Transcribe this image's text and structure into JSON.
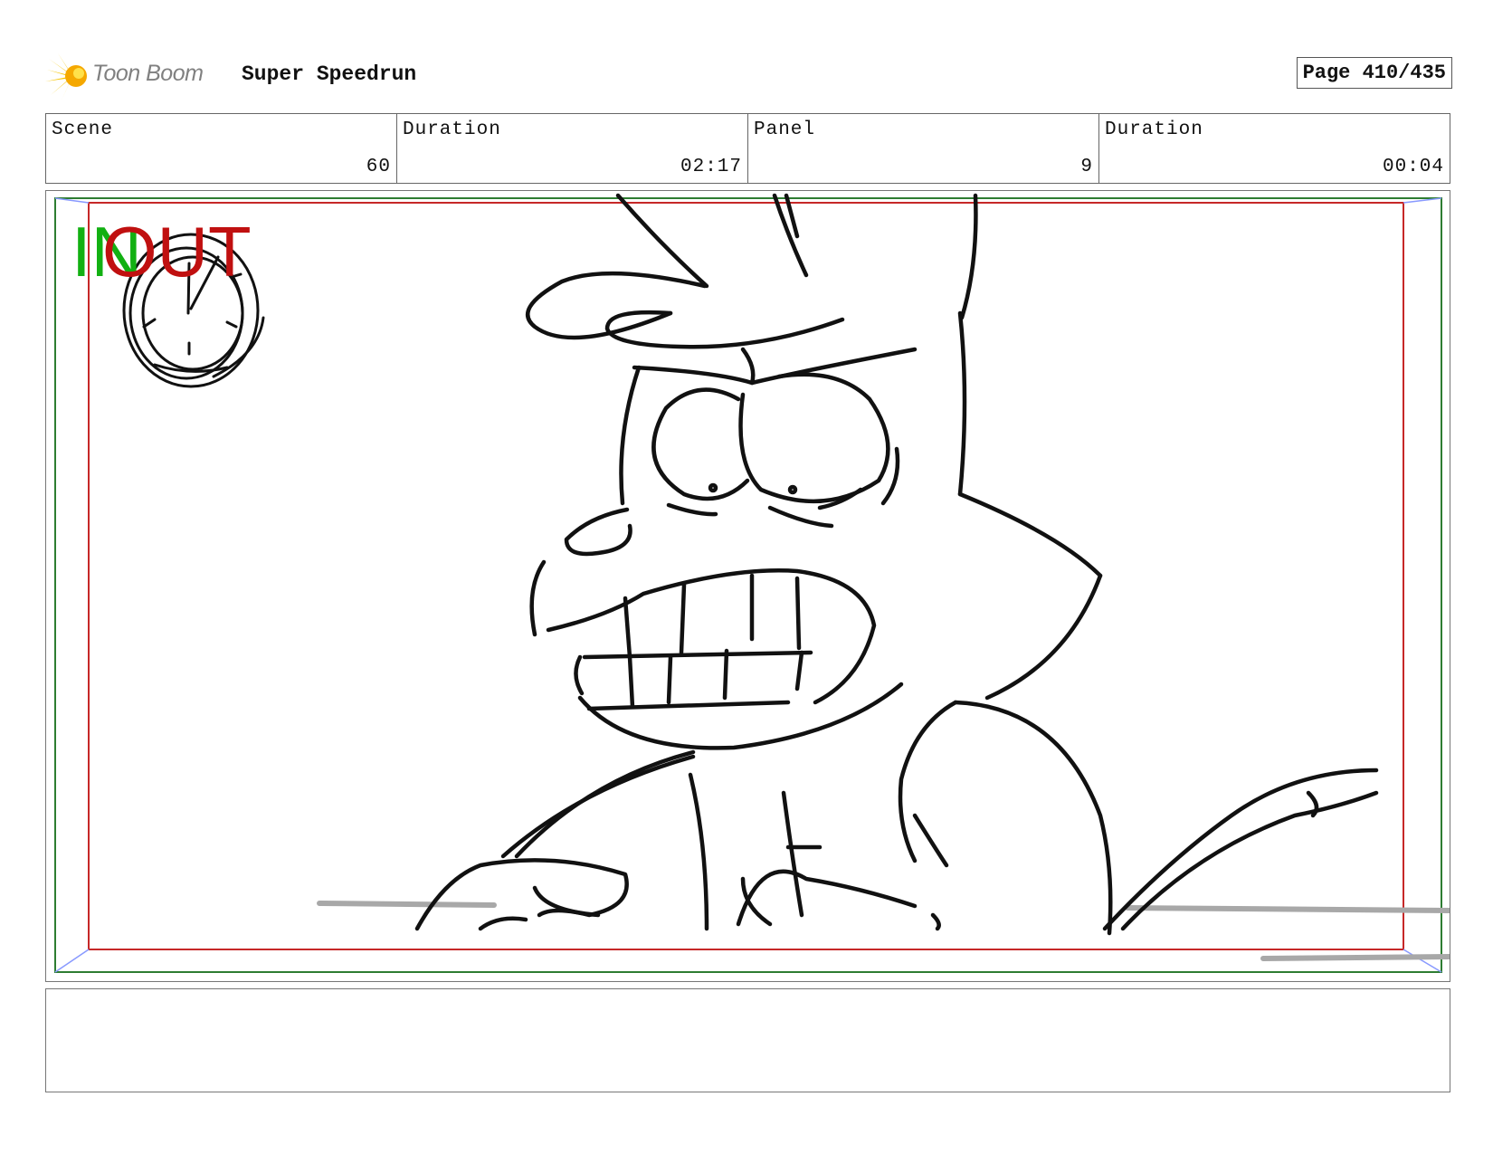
{
  "header": {
    "logo_text": "Toon Boom",
    "project_title": "Super Speedrun",
    "page_label": "Page 410/435"
  },
  "info": {
    "scene_label": "Scene",
    "scene_value": "60",
    "scene_duration_label": "Duration",
    "scene_duration_value": "02:17",
    "panel_label": "Panel",
    "panel_value": "9",
    "panel_duration_label": "Duration",
    "panel_duration_value": "00:04"
  },
  "panel": {
    "in_marker": "IN",
    "out_marker": "OUT"
  },
  "notes": {
    "text": ""
  },
  "colors": {
    "in_marker": "#12b012",
    "out_marker": "#c01010",
    "safe_frame_outer": "#2e7d32",
    "safe_frame_inner": "#c62828",
    "logo_star": "#f5c400"
  }
}
